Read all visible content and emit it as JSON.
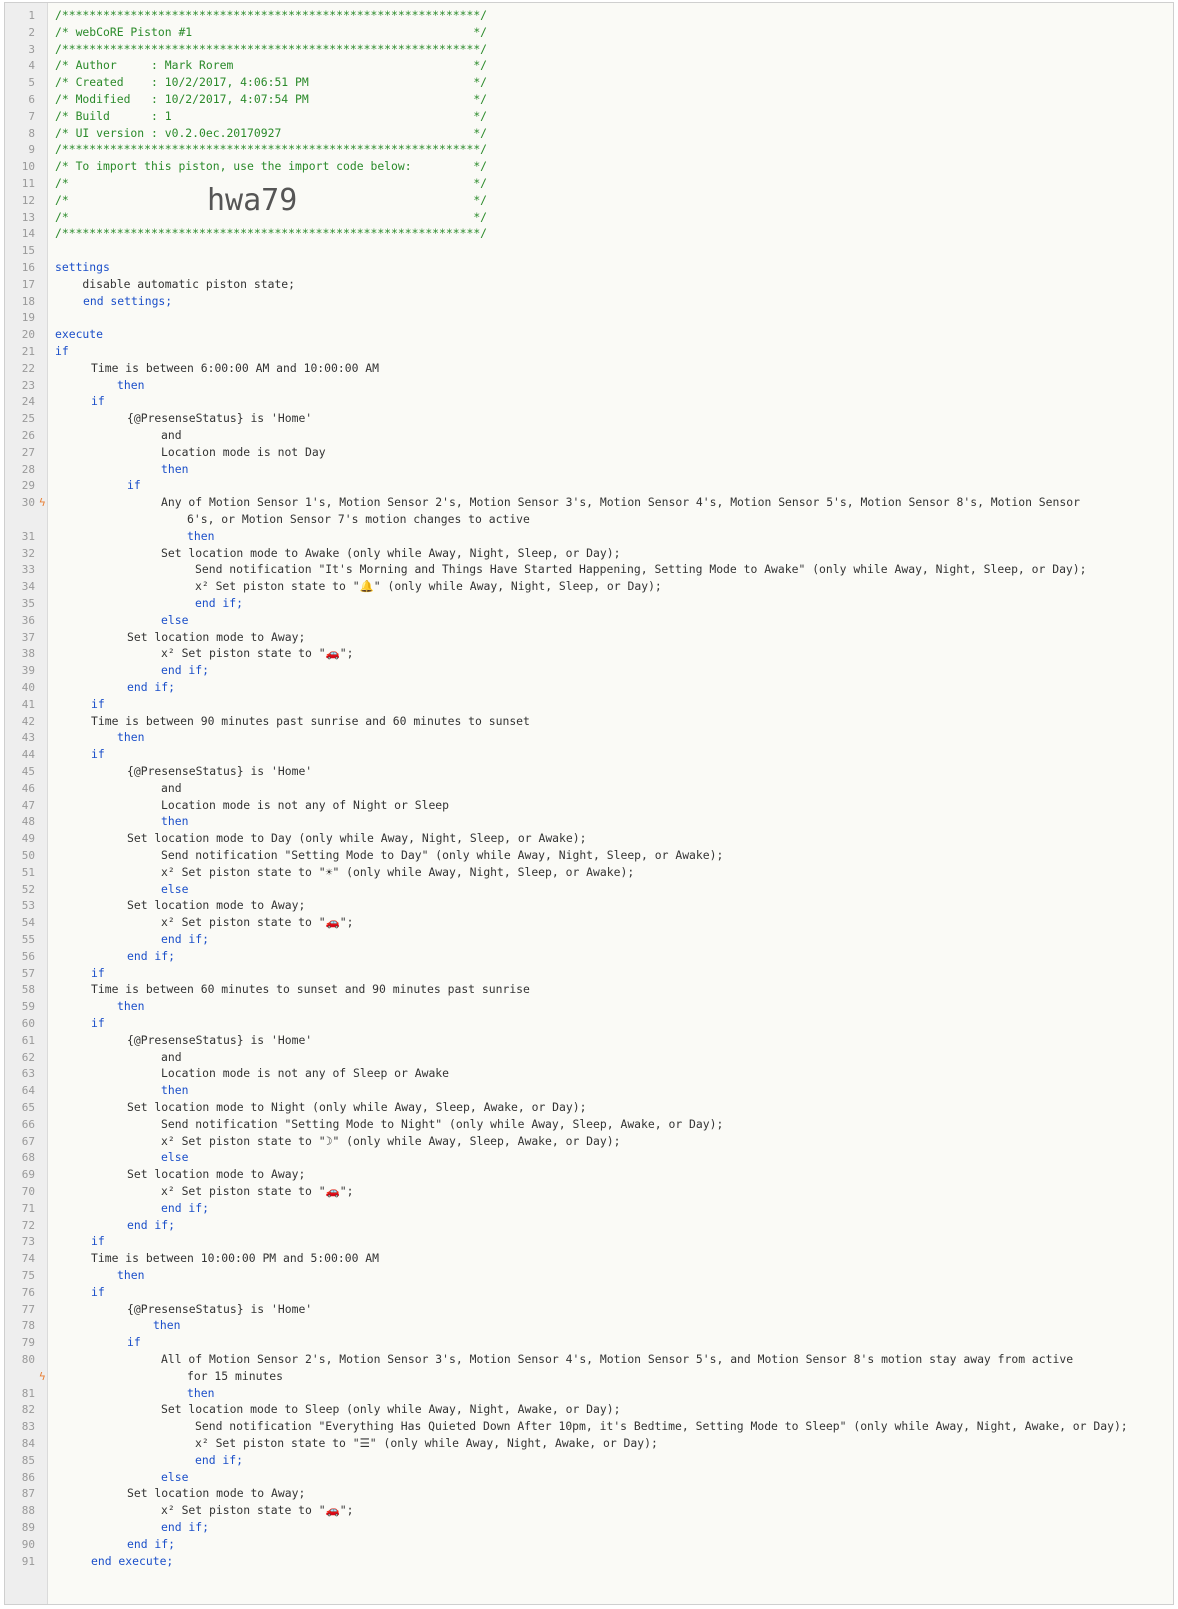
{
  "editor": {
    "import_code": "hwa79",
    "lines": [
      {
        "n": "1",
        "t": "/*************************************************************/"
      },
      {
        "n": "2",
        "t": "/* webCoRE Piston #1                                         */"
      },
      {
        "n": "3",
        "t": "/*************************************************************/"
      },
      {
        "n": "4",
        "t": "/* Author     : Mark Rorem                                   */"
      },
      {
        "n": "5",
        "t": "/* Created    : 10/2/2017, 4:06:51 PM                        */"
      },
      {
        "n": "6",
        "t": "/* Modified   : 10/2/2017, 4:07:54 PM                        */"
      },
      {
        "n": "7",
        "t": "/* Build      : 1                                            */"
      },
      {
        "n": "8",
        "t": "/* UI version : v0.2.0ec.20170927                            */"
      },
      {
        "n": "9",
        "t": "/*************************************************************/"
      },
      {
        "n": "10",
        "t": "/* To import this piston, use the import code below:         */"
      },
      {
        "n": "11",
        "t": "/*                                                           */"
      },
      {
        "n": "12",
        "t": "/*                                                           */"
      },
      {
        "n": "13",
        "t": "/*                                                           */"
      },
      {
        "n": "14",
        "t": "/*************************************************************/"
      },
      {
        "n": "15",
        "t": ""
      },
      {
        "n": "16",
        "t": "settings"
      },
      {
        "n": "17",
        "t": "    disable automatic piston state;"
      },
      {
        "n": "18",
        "t": "end settings;"
      },
      {
        "n": "19",
        "t": ""
      },
      {
        "n": "20",
        "t": "execute"
      },
      {
        "n": "21",
        "t": "if"
      },
      {
        "n": "22",
        "t": "Time is between 6:00:00 AM and 10:00:00 AM"
      },
      {
        "n": "23",
        "t": "then"
      },
      {
        "n": "24",
        "t": "if"
      },
      {
        "n": "25",
        "t": "{@PresenseStatus} is 'Home'"
      },
      {
        "n": "26",
        "t": "and"
      },
      {
        "n": "27",
        "t": "Location mode is not Day"
      },
      {
        "n": "28",
        "t": "then"
      },
      {
        "n": "29",
        "t": "if"
      },
      {
        "n": "30",
        "t": "Any of Motion Sensor 1's, Motion Sensor 2's, Motion Sensor 3's, Motion Sensor 4's, Motion Sensor 5's, Motion Sensor 8's, Motion Sensor"
      },
      {
        "n": "",
        "t": "6's, or Motion Sensor 7's motion changes to active"
      },
      {
        "n": "31",
        "t": "then"
      },
      {
        "n": "32",
        "t": "Set location mode to Awake (only while Away, Night, Sleep, or Day);"
      },
      {
        "n": "33",
        "t": "Send notification \"It's Morning and Things Have Started Happening, Setting Mode to Awake\" (only while Away, Night, Sleep, or Day);"
      },
      {
        "n": "34",
        "t": "x² Set piston state to \"🔔\" (only while Away, Night, Sleep, or Day);"
      },
      {
        "n": "35",
        "t": "end if;"
      },
      {
        "n": "36",
        "t": "else"
      },
      {
        "n": "37",
        "t": "Set location mode to Away;"
      },
      {
        "n": "38",
        "t": "x² Set piston state to \"🚗\";"
      },
      {
        "n": "39",
        "t": "end if;"
      },
      {
        "n": "40",
        "t": "end if;"
      },
      {
        "n": "41",
        "t": "if"
      },
      {
        "n": "42",
        "t": "Time is between 90 minutes past sunrise and 60 minutes to sunset"
      },
      {
        "n": "43",
        "t": "then"
      },
      {
        "n": "44",
        "t": "if"
      },
      {
        "n": "45",
        "t": "{@PresenseStatus} is 'Home'"
      },
      {
        "n": "46",
        "t": "and"
      },
      {
        "n": "47",
        "t": "Location mode is not any of Night or Sleep"
      },
      {
        "n": "48",
        "t": "then"
      },
      {
        "n": "49",
        "t": "Set location mode to Day (only while Away, Night, Sleep, or Awake);"
      },
      {
        "n": "50",
        "t": "Send notification \"Setting Mode to Day\" (only while Away, Night, Sleep, or Awake);"
      },
      {
        "n": "51",
        "t": "x² Set piston state to \"☀\" (only while Away, Night, Sleep, or Awake);"
      },
      {
        "n": "52",
        "t": "else"
      },
      {
        "n": "53",
        "t": "Set location mode to Away;"
      },
      {
        "n": "54",
        "t": "x² Set piston state to \"🚗\";"
      },
      {
        "n": "55",
        "t": "end if;"
      },
      {
        "n": "56",
        "t": "end if;"
      },
      {
        "n": "57",
        "t": "if"
      },
      {
        "n": "58",
        "t": "Time is between 60 minutes to sunset and 90 minutes past sunrise"
      },
      {
        "n": "59",
        "t": "then"
      },
      {
        "n": "60",
        "t": "if"
      },
      {
        "n": "61",
        "t": "{@PresenseStatus} is 'Home'"
      },
      {
        "n": "62",
        "t": "and"
      },
      {
        "n": "63",
        "t": "Location mode is not any of Sleep or Awake"
      },
      {
        "n": "64",
        "t": "then"
      },
      {
        "n": "65",
        "t": "Set location mode to Night (only while Away, Sleep, Awake, or Day);"
      },
      {
        "n": "66",
        "t": "Send notification \"Setting Mode to Night\" (only while Away, Sleep, Awake, or Day);"
      },
      {
        "n": "67",
        "t": "x² Set piston state to \"☽\" (only while Away, Sleep, Awake, or Day);"
      },
      {
        "n": "68",
        "t": "else"
      },
      {
        "n": "69",
        "t": "Set location mode to Away;"
      },
      {
        "n": "70",
        "t": "x² Set piston state to \"🚗\";"
      },
      {
        "n": "71",
        "t": "end if;"
      },
      {
        "n": "72",
        "t": "end if;"
      },
      {
        "n": "73",
        "t": "if"
      },
      {
        "n": "74",
        "t": "Time is between 10:00:00 PM and 5:00:00 AM"
      },
      {
        "n": "75",
        "t": "then"
      },
      {
        "n": "76",
        "t": "if"
      },
      {
        "n": "77",
        "t": "{@PresenseStatus} is 'Home'"
      },
      {
        "n": "78",
        "t": "then"
      },
      {
        "n": "79",
        "t": "if"
      },
      {
        "n": "80",
        "t": "All of Motion Sensor 2's, Motion Sensor 3's, Motion Sensor 4's, Motion Sensor 5's, and Motion Sensor 8's motion stay away from active"
      },
      {
        "n": "",
        "t": "for 15 minutes"
      },
      {
        "n": "81",
        "t": "then"
      },
      {
        "n": "82",
        "t": "Set location mode to Sleep (only while Away, Night, Awake, or Day);"
      },
      {
        "n": "83",
        "t": "Send notification \"Everything Has Quieted Down After 10pm, it's Bedtime, Setting Mode to Sleep\" (only while Away, Night, Awake, or Day);"
      },
      {
        "n": "84",
        "t": "x² Set piston state to \"☰\" (only while Away, Night, Awake, or Day);"
      },
      {
        "n": "85",
        "t": "end if;"
      },
      {
        "n": "86",
        "t": "else"
      },
      {
        "n": "87",
        "t": "Set location mode to Away;"
      },
      {
        "n": "88",
        "t": "x² Set piston state to \"🚗\";"
      },
      {
        "n": "89",
        "t": "end if;"
      },
      {
        "n": "90",
        "t": "end if;"
      },
      {
        "n": "91",
        "t": "end execute;"
      }
    ]
  }
}
